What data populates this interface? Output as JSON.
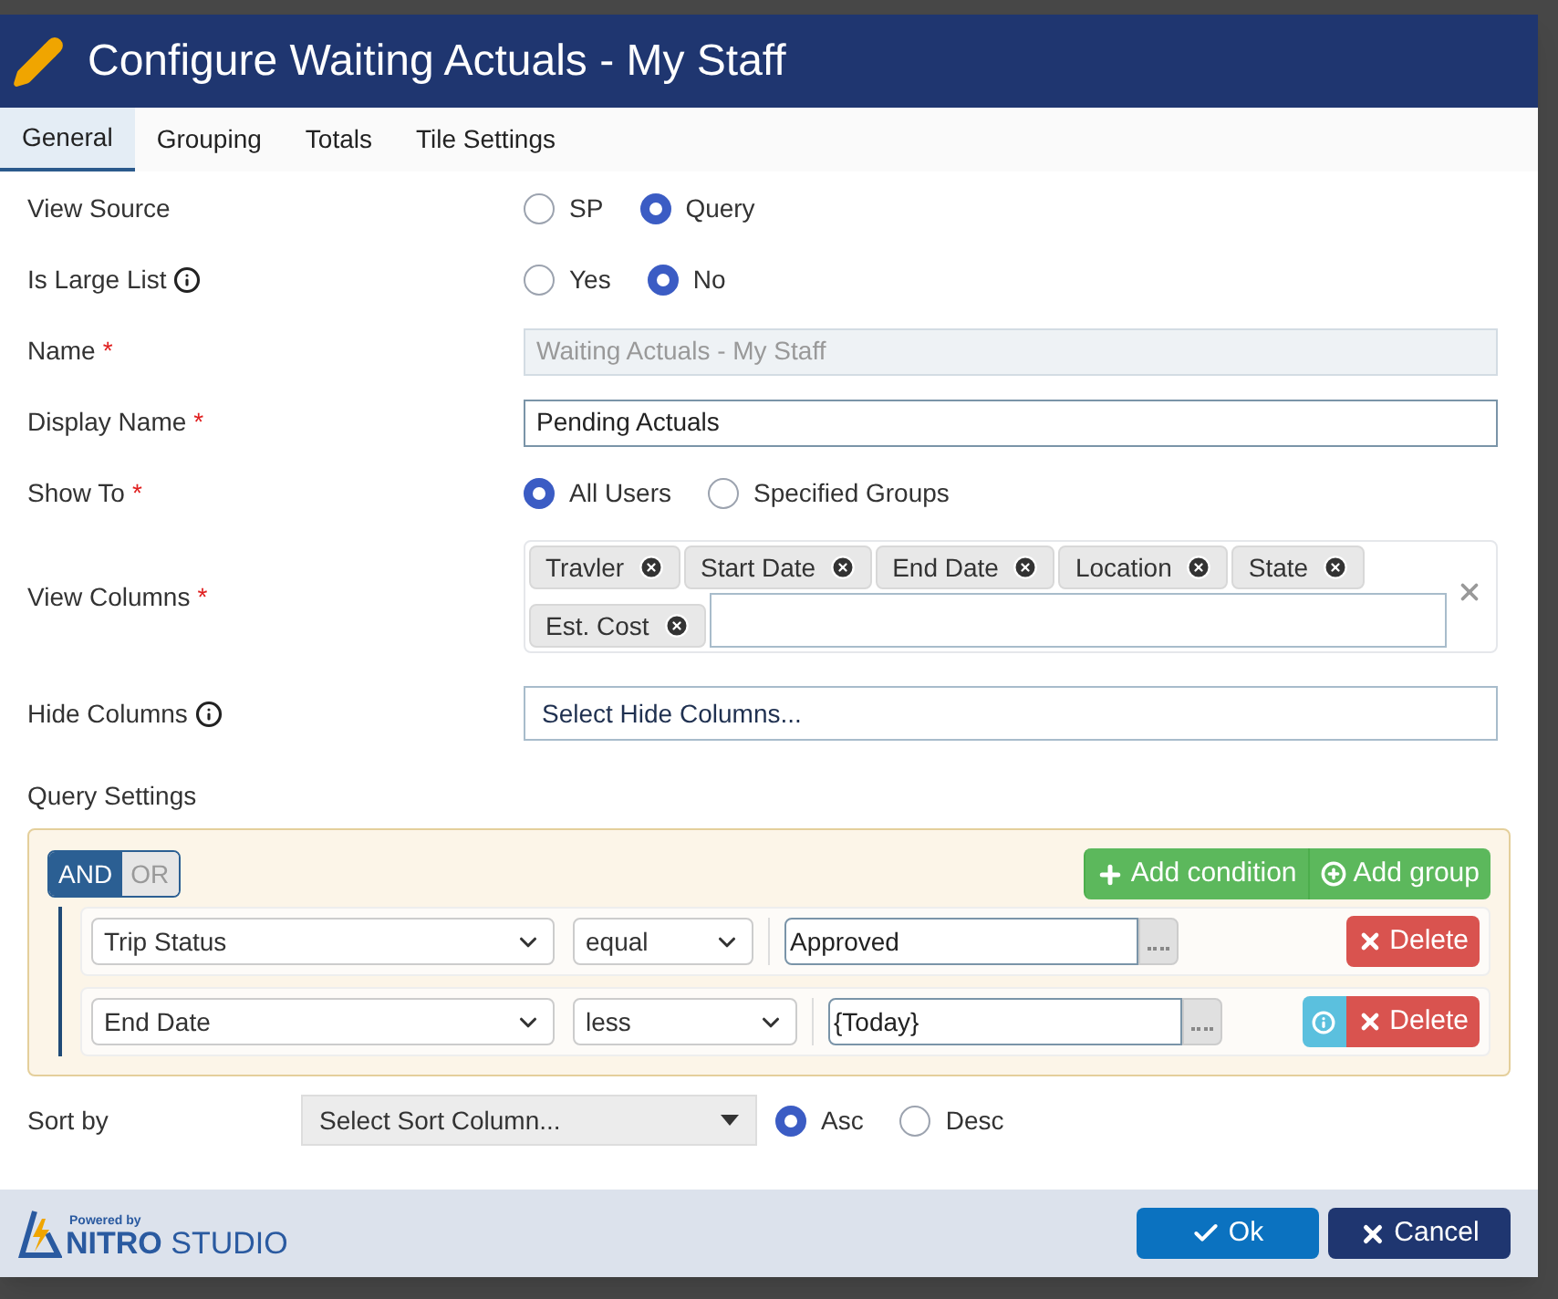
{
  "dialog": {
    "title": "Configure Waiting Actuals - My Staff",
    "tabs": [
      {
        "label": "General",
        "selected": true
      },
      {
        "label": "Grouping",
        "selected": false
      },
      {
        "label": "Totals",
        "selected": false
      },
      {
        "label": "Tile Settings",
        "selected": false
      }
    ],
    "fields": [
      {
        "kind": "radio",
        "label": "View Source",
        "options": [
          {
            "label": "SP",
            "selected": false
          },
          {
            "label": "Query",
            "selected": true
          }
        ]
      },
      {
        "kind": "radio",
        "label": "Is Large List",
        "info": true,
        "options": [
          {
            "label": "Yes",
            "selected": false
          },
          {
            "label": "No",
            "selected": true
          }
        ]
      },
      {
        "kind": "text",
        "label": "Name",
        "required_mark": "*",
        "value": "Waiting Actuals - My Staff",
        "disabled": true
      },
      {
        "kind": "text",
        "label": "Display Name",
        "required_mark": "*",
        "value": "Pending Actuals",
        "disabled": false
      },
      {
        "kind": "radio",
        "label": "Show To",
        "required_mark": "*",
        "options": [
          {
            "label": "All Users",
            "selected": true
          },
          {
            "label": "Specified Groups",
            "selected": false
          }
        ]
      },
      {
        "kind": "tags",
        "label": "View Columns",
        "required_mark": "*",
        "tags": [
          "Travler",
          "Start Date",
          "End Date",
          "Location",
          "State",
          "Est. Cost"
        ]
      },
      {
        "kind": "select",
        "label": "Hide Columns",
        "info": true,
        "placeholder": "Select Hide Columns..."
      }
    ],
    "query": {
      "label": "Query Settings",
      "conjunctions": [
        {
          "label": "AND",
          "selected": true
        },
        {
          "label": "OR",
          "selected": false
        }
      ],
      "buttons": [
        {
          "kind": "plus",
          "label": "Add condition"
        },
        {
          "kind": "circle-plus",
          "label": "Add group"
        }
      ],
      "rules": [
        {
          "field": "Trip Status",
          "operator": "equal",
          "value": "Approved",
          "delete": "Delete"
        },
        {
          "field": "End Date",
          "operator": "less",
          "value": "{Today}",
          "info": true,
          "delete": "Delete"
        }
      ]
    },
    "sort": {
      "label": "Sort by",
      "placeholder": "Select Sort Column...",
      "options": [
        {
          "label": "Asc",
          "selected": true
        },
        {
          "label": "Desc",
          "selected": false
        }
      ]
    },
    "footer": {
      "powered_by": "Powered by",
      "brand_bold": "NITRO",
      "brand": "STUDIO",
      "buttons": [
        {
          "kind": "primary",
          "label": "Ok"
        },
        {
          "kind": "dark",
          "label": "Cancel"
        }
      ]
    }
  }
}
